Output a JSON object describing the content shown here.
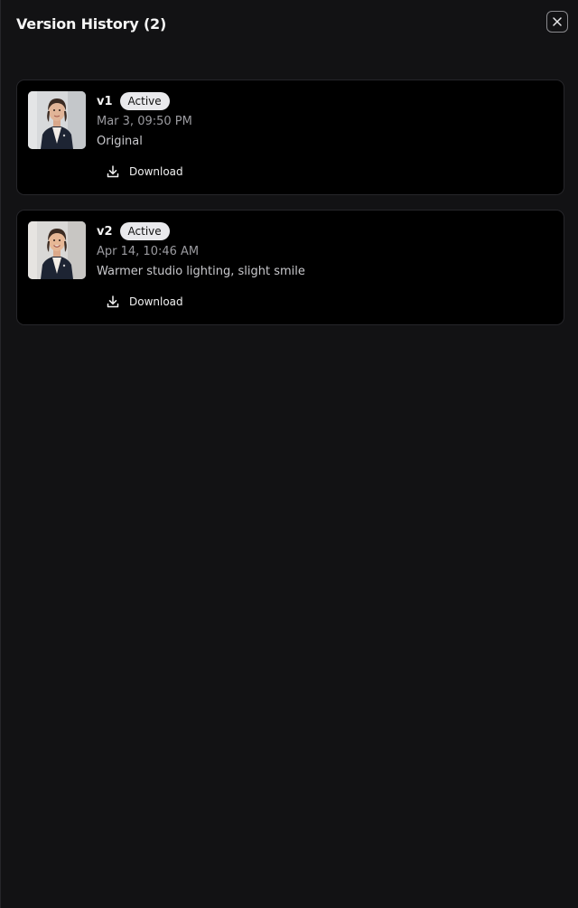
{
  "header": {
    "title": "Version History (2)"
  },
  "versions": [
    {
      "label": "v1",
      "badge": "Active",
      "date": "Mar 3, 09:50 PM",
      "description": "Original",
      "download_label": "Download"
    },
    {
      "label": "v2",
      "badge": "Active",
      "date": "Apr 14, 10:46 AM",
      "description": "Warmer studio lighting, slight smile",
      "download_label": "Download"
    }
  ],
  "icons": {
    "close": "close-icon",
    "download": "download-icon",
    "thumbnail": "portrait-thumbnail"
  },
  "colors": {
    "panel_bg": "#121214",
    "card_bg": "#000000",
    "badge_bg": "#e9e9ec",
    "muted_text": "#9b9ba0"
  }
}
